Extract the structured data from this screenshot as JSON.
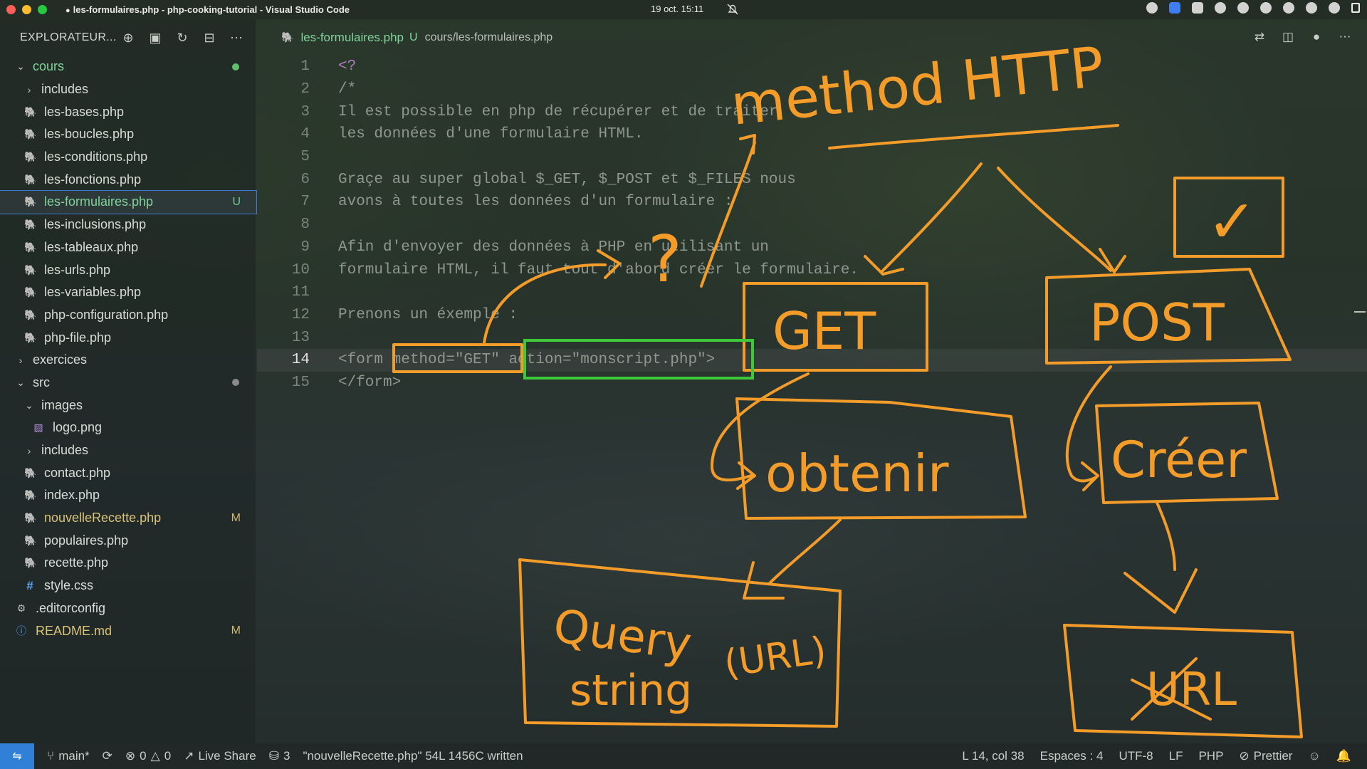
{
  "window": {
    "title": "les-formulaires.php - php-cooking-tutorial - Visual Studio Code",
    "clock": "19 oct.  15:11"
  },
  "sidebar": {
    "header": "EXPLORATEUR...",
    "tree": [
      {
        "label": "cours",
        "kind": "folder-open",
        "depth": 0,
        "color": "green",
        "dot": "#5fbf6a"
      },
      {
        "label": "includes",
        "kind": "folder",
        "depth": 1
      },
      {
        "label": "les-bases.php",
        "kind": "php",
        "depth": 1
      },
      {
        "label": "les-boucles.php",
        "kind": "php",
        "depth": 1
      },
      {
        "label": "les-conditions.php",
        "kind": "php",
        "depth": 1
      },
      {
        "label": "les-fonctions.php",
        "kind": "php",
        "depth": 1
      },
      {
        "label": "les-formulaires.php",
        "kind": "php",
        "depth": 1,
        "badge": "U",
        "selected": true
      },
      {
        "label": "les-inclusions.php",
        "kind": "php",
        "depth": 1
      },
      {
        "label": "les-tableaux.php",
        "kind": "php",
        "depth": 1
      },
      {
        "label": "les-urls.php",
        "kind": "php",
        "depth": 1
      },
      {
        "label": "les-variables.php",
        "kind": "php",
        "depth": 1
      },
      {
        "label": "php-configuration.php",
        "kind": "php",
        "depth": 1
      },
      {
        "label": "php-file.php",
        "kind": "php",
        "depth": 1
      },
      {
        "label": "exercices",
        "kind": "folder",
        "depth": 0
      },
      {
        "label": "src",
        "kind": "folder-open",
        "depth": 0,
        "dot": "#8a8a8a"
      },
      {
        "label": "images",
        "kind": "folder-open",
        "depth": 1
      },
      {
        "label": "logo.png",
        "kind": "img",
        "depth": 2
      },
      {
        "label": "includes",
        "kind": "folder",
        "depth": 1
      },
      {
        "label": "contact.php",
        "kind": "php",
        "depth": 1
      },
      {
        "label": "index.php",
        "kind": "php",
        "depth": 1
      },
      {
        "label": "nouvelleRecette.php",
        "kind": "php",
        "depth": 1,
        "badge": "M",
        "color": "yellow"
      },
      {
        "label": "populaires.php",
        "kind": "php",
        "depth": 1
      },
      {
        "label": "recette.php",
        "kind": "php",
        "depth": 1
      },
      {
        "label": "style.css",
        "kind": "css",
        "depth": 1
      },
      {
        "label": ".editorconfig",
        "kind": "gear",
        "depth": 0
      },
      {
        "label": "README.md",
        "kind": "info",
        "depth": 0,
        "badge": "M",
        "color": "yellow"
      }
    ]
  },
  "tab": {
    "name": "les-formulaires.php",
    "status": "U",
    "path": "cours/les-formulaires.php"
  },
  "code": {
    "active_line": 14,
    "lines": [
      "<?",
      "/*",
      "Il est possible en php de récupérer et de traiter",
      "les données d'une formulaire HTML.",
      "",
      "Graçe au super global $_GET, $_POST et $_FILES nous",
      "avons à toutes les données d'un formulaire :",
      "",
      "Afin d'envoyer des données à PHP en utilisant un",
      "formulaire HTML, il faut tout d'abord créer le formulaire.",
      "",
      "Prenons un éxemple :",
      "",
      "<form method=\"GET\" action=\"monscript.php\">",
      "</form>"
    ]
  },
  "annotations": {
    "title": "method HTTP",
    "get": "GET",
    "post": "POST",
    "obtenir": "obtenir",
    "creer": "Créer",
    "query1": "Query",
    "query2": "string",
    "url_paren": "(URL)",
    "url_crossed": "URL",
    "checkmark": "✓",
    "question": "?"
  },
  "statusbar": {
    "branch": "main*",
    "errors": "0",
    "warnings": "0",
    "live_share": "Live Share",
    "count": "3",
    "message": "\"nouvelleRecette.php\" 54L 1456C written",
    "position": "L 14, col 38",
    "spaces": "Espaces : 4",
    "encoding": "UTF-8",
    "eol": "LF",
    "language": "PHP",
    "formatter": "Prettier"
  },
  "colors": {
    "ink_orange": "#f39c2a",
    "ink_green": "#3ec93a",
    "accent_blue": "#2f80d6"
  }
}
